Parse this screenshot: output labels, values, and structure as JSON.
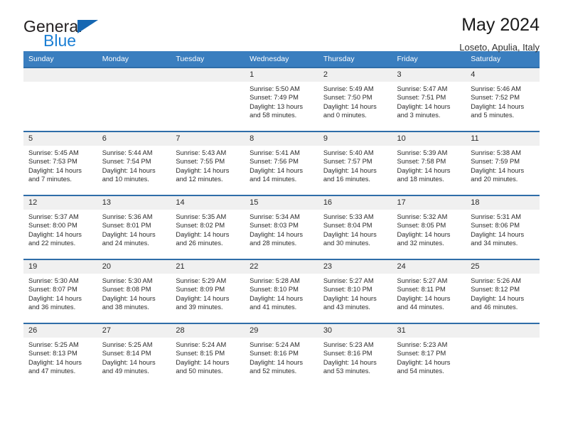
{
  "brand": {
    "line1": "General",
    "line2": "Blue",
    "logo_icon": "triangle-logo-icon"
  },
  "header": {
    "title": "May 2024",
    "location": "Loseto, Apulia, Italy"
  },
  "calendar": {
    "weekdays": [
      "Sunday",
      "Monday",
      "Tuesday",
      "Wednesday",
      "Thursday",
      "Friday",
      "Saturday"
    ],
    "accent_color": "#3a7ebf",
    "border_color": "#2f6da8",
    "daynum_band_color": "#f0f0f0",
    "weeks": [
      [
        {
          "day": ""
        },
        {
          "day": ""
        },
        {
          "day": ""
        },
        {
          "day": "1",
          "sunrise": "Sunrise: 5:50 AM",
          "sunset": "Sunset: 7:49 PM",
          "daylight1": "Daylight: 13 hours",
          "daylight2": "and 58 minutes."
        },
        {
          "day": "2",
          "sunrise": "Sunrise: 5:49 AM",
          "sunset": "Sunset: 7:50 PM",
          "daylight1": "Daylight: 14 hours",
          "daylight2": "and 0 minutes."
        },
        {
          "day": "3",
          "sunrise": "Sunrise: 5:47 AM",
          "sunset": "Sunset: 7:51 PM",
          "daylight1": "Daylight: 14 hours",
          "daylight2": "and 3 minutes."
        },
        {
          "day": "4",
          "sunrise": "Sunrise: 5:46 AM",
          "sunset": "Sunset: 7:52 PM",
          "daylight1": "Daylight: 14 hours",
          "daylight2": "and 5 minutes."
        }
      ],
      [
        {
          "day": "5",
          "sunrise": "Sunrise: 5:45 AM",
          "sunset": "Sunset: 7:53 PM",
          "daylight1": "Daylight: 14 hours",
          "daylight2": "and 7 minutes."
        },
        {
          "day": "6",
          "sunrise": "Sunrise: 5:44 AM",
          "sunset": "Sunset: 7:54 PM",
          "daylight1": "Daylight: 14 hours",
          "daylight2": "and 10 minutes."
        },
        {
          "day": "7",
          "sunrise": "Sunrise: 5:43 AM",
          "sunset": "Sunset: 7:55 PM",
          "daylight1": "Daylight: 14 hours",
          "daylight2": "and 12 minutes."
        },
        {
          "day": "8",
          "sunrise": "Sunrise: 5:41 AM",
          "sunset": "Sunset: 7:56 PM",
          "daylight1": "Daylight: 14 hours",
          "daylight2": "and 14 minutes."
        },
        {
          "day": "9",
          "sunrise": "Sunrise: 5:40 AM",
          "sunset": "Sunset: 7:57 PM",
          "daylight1": "Daylight: 14 hours",
          "daylight2": "and 16 minutes."
        },
        {
          "day": "10",
          "sunrise": "Sunrise: 5:39 AM",
          "sunset": "Sunset: 7:58 PM",
          "daylight1": "Daylight: 14 hours",
          "daylight2": "and 18 minutes."
        },
        {
          "day": "11",
          "sunrise": "Sunrise: 5:38 AM",
          "sunset": "Sunset: 7:59 PM",
          "daylight1": "Daylight: 14 hours",
          "daylight2": "and 20 minutes."
        }
      ],
      [
        {
          "day": "12",
          "sunrise": "Sunrise: 5:37 AM",
          "sunset": "Sunset: 8:00 PM",
          "daylight1": "Daylight: 14 hours",
          "daylight2": "and 22 minutes."
        },
        {
          "day": "13",
          "sunrise": "Sunrise: 5:36 AM",
          "sunset": "Sunset: 8:01 PM",
          "daylight1": "Daylight: 14 hours",
          "daylight2": "and 24 minutes."
        },
        {
          "day": "14",
          "sunrise": "Sunrise: 5:35 AM",
          "sunset": "Sunset: 8:02 PM",
          "daylight1": "Daylight: 14 hours",
          "daylight2": "and 26 minutes."
        },
        {
          "day": "15",
          "sunrise": "Sunrise: 5:34 AM",
          "sunset": "Sunset: 8:03 PM",
          "daylight1": "Daylight: 14 hours",
          "daylight2": "and 28 minutes."
        },
        {
          "day": "16",
          "sunrise": "Sunrise: 5:33 AM",
          "sunset": "Sunset: 8:04 PM",
          "daylight1": "Daylight: 14 hours",
          "daylight2": "and 30 minutes."
        },
        {
          "day": "17",
          "sunrise": "Sunrise: 5:32 AM",
          "sunset": "Sunset: 8:05 PM",
          "daylight1": "Daylight: 14 hours",
          "daylight2": "and 32 minutes."
        },
        {
          "day": "18",
          "sunrise": "Sunrise: 5:31 AM",
          "sunset": "Sunset: 8:06 PM",
          "daylight1": "Daylight: 14 hours",
          "daylight2": "and 34 minutes."
        }
      ],
      [
        {
          "day": "19",
          "sunrise": "Sunrise: 5:30 AM",
          "sunset": "Sunset: 8:07 PM",
          "daylight1": "Daylight: 14 hours",
          "daylight2": "and 36 minutes."
        },
        {
          "day": "20",
          "sunrise": "Sunrise: 5:30 AM",
          "sunset": "Sunset: 8:08 PM",
          "daylight1": "Daylight: 14 hours",
          "daylight2": "and 38 minutes."
        },
        {
          "day": "21",
          "sunrise": "Sunrise: 5:29 AM",
          "sunset": "Sunset: 8:09 PM",
          "daylight1": "Daylight: 14 hours",
          "daylight2": "and 39 minutes."
        },
        {
          "day": "22",
          "sunrise": "Sunrise: 5:28 AM",
          "sunset": "Sunset: 8:10 PM",
          "daylight1": "Daylight: 14 hours",
          "daylight2": "and 41 minutes."
        },
        {
          "day": "23",
          "sunrise": "Sunrise: 5:27 AM",
          "sunset": "Sunset: 8:10 PM",
          "daylight1": "Daylight: 14 hours",
          "daylight2": "and 43 minutes."
        },
        {
          "day": "24",
          "sunrise": "Sunrise: 5:27 AM",
          "sunset": "Sunset: 8:11 PM",
          "daylight1": "Daylight: 14 hours",
          "daylight2": "and 44 minutes."
        },
        {
          "day": "25",
          "sunrise": "Sunrise: 5:26 AM",
          "sunset": "Sunset: 8:12 PM",
          "daylight1": "Daylight: 14 hours",
          "daylight2": "and 46 minutes."
        }
      ],
      [
        {
          "day": "26",
          "sunrise": "Sunrise: 5:25 AM",
          "sunset": "Sunset: 8:13 PM",
          "daylight1": "Daylight: 14 hours",
          "daylight2": "and 47 minutes."
        },
        {
          "day": "27",
          "sunrise": "Sunrise: 5:25 AM",
          "sunset": "Sunset: 8:14 PM",
          "daylight1": "Daylight: 14 hours",
          "daylight2": "and 49 minutes."
        },
        {
          "day": "28",
          "sunrise": "Sunrise: 5:24 AM",
          "sunset": "Sunset: 8:15 PM",
          "daylight1": "Daylight: 14 hours",
          "daylight2": "and 50 minutes."
        },
        {
          "day": "29",
          "sunrise": "Sunrise: 5:24 AM",
          "sunset": "Sunset: 8:16 PM",
          "daylight1": "Daylight: 14 hours",
          "daylight2": "and 52 minutes."
        },
        {
          "day": "30",
          "sunrise": "Sunrise: 5:23 AM",
          "sunset": "Sunset: 8:16 PM",
          "daylight1": "Daylight: 14 hours",
          "daylight2": "and 53 minutes."
        },
        {
          "day": "31",
          "sunrise": "Sunrise: 5:23 AM",
          "sunset": "Sunset: 8:17 PM",
          "daylight1": "Daylight: 14 hours",
          "daylight2": "and 54 minutes."
        },
        {
          "day": ""
        }
      ]
    ]
  }
}
